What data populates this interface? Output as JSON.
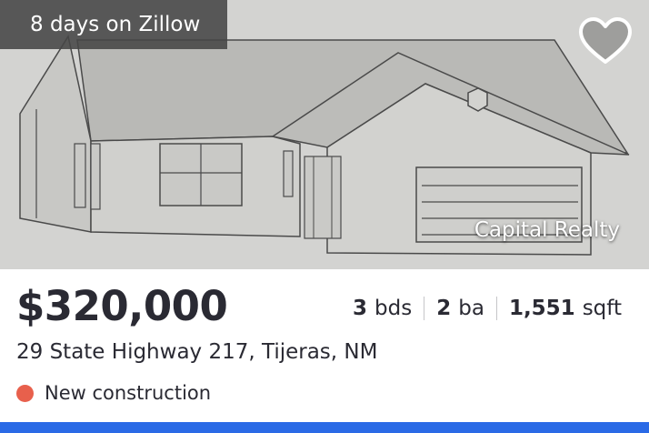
{
  "listing": {
    "days_on_market_text": "8 days on Zillow",
    "broker": "Capital Realty",
    "price": "$320,000",
    "beds_num": "3",
    "beds_unit": "bds",
    "baths_num": "2",
    "baths_unit": "ba",
    "sqft_num": "1,551",
    "sqft_unit": "sqft",
    "address": "29 State Highway 217, Tijeras, NM",
    "status": "New construction"
  },
  "icons": {
    "favorite": "heart-icon",
    "status_indicator": "dot"
  },
  "colors": {
    "status_dot": "#e8604c",
    "bottom_bar": "#2a6ae6",
    "text": "#2a2a33"
  }
}
